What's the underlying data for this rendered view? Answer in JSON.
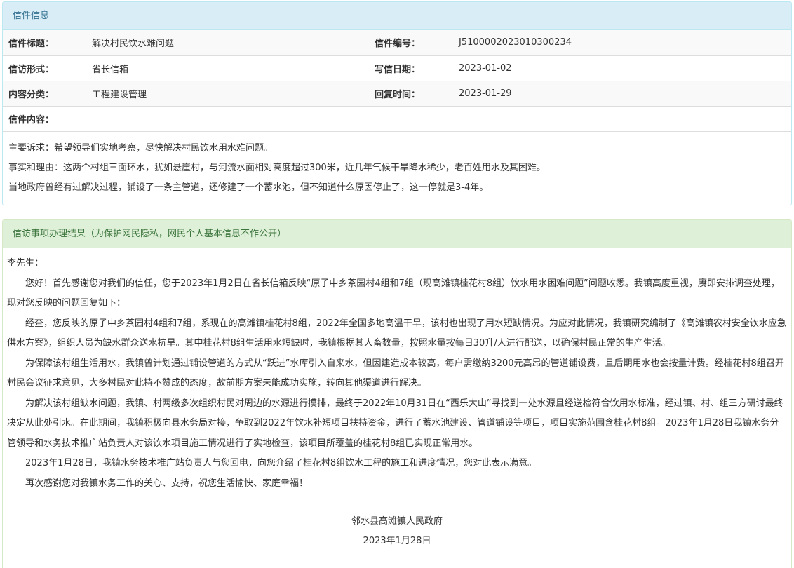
{
  "info": {
    "heading": "信件信息",
    "rows": [
      {
        "l1": "信件标题：",
        "v1": "解决村民饮水难问题",
        "l2": "信件编号：",
        "v2": "J5100002023010300234"
      },
      {
        "l1": "信访形式：",
        "v1": "省长信箱",
        "l2": "写信日期：",
        "v2": "2023-01-02"
      },
      {
        "l1": "内容分类：",
        "v1": "工程建设管理",
        "l2": "回复时间：",
        "v2": "2023-01-29"
      }
    ],
    "content_label": "信件内容：",
    "content_lines": [
      "主要诉求：希望领导们实地考察，尽快解决村民饮水用水难问题。",
      "事实和理由：这两个村组三面环水，犹如悬崖村，与河流水面相对高度超过300米，近几年气候干旱降水稀少，老百姓用水及其困难。",
      "当地政府曾经有过解决过程，铺设了一条主管道，还修建了一个蓄水池，但不知道什么原因停止了，这一停就是3-4年。"
    ]
  },
  "result": {
    "heading": "信访事项办理结果（为保护网民隐私，网民个人基本信息不作公开）",
    "salutation": "李先生：",
    "paragraphs": [
      "您好！首先感谢您对我们的信任，您于2023年1月2日在省长信箱反映“原子中乡茶园村4组和7组（现高滩镇桂花村8组）饮水用水困难问题”问题收悉。我镇高度重视，赓即安排调查处理，现对您反映的问题回复如下：",
      "经查，您反映的原子中乡茶园村4组和7组，系现在的高滩镇桂花村8组，2022年全国多地高温干旱，该村也出现了用水短缺情况。为应对此情况，我镇研究编制了《高滩镇农村安全饮水应急供水方案》，组织人员为缺水群众送水抗旱。其中桂花村8组生活用水短缺时，我镇根据其人畜数量，按照水量按每日30升/人进行配送，以确保村民正常的生产生活。",
      "为保障该村组生活用水，我镇曾计划通过铺设管道的方式从“跃进”水库引入自来水，但因建造成本较高，每户需缴纳3200元高昂的管道铺设费，且后期用水也会按量计费。经桂花村8组召开村民会议征求意见，大多村民对此持不赞成的态度，故前期方案未能成功实施，转向其他渠道进行解决。",
      "为解决该村组缺水问题，我镇、村两级多次组织村民对周边的水源进行摸排，最终于2022年10月31日在“西乐大山”寻找到一处水源且经送检符合饮用水标准，经过镇、村、组三方研讨最终决定从此处引水。在此期间，我镇积极向县水务局对接，争取到2022年饮水补短项目扶持资金，进行了蓄水池建设、管道铺设等项目，项目实施范围含桂花村8组。2023年1月28日我镇水务分管领导和水务技术推广站负责人对该饮水项目施工情况进行了实地检查，该项目所覆盖的桂花村8组已实现正常用水。",
      "2023年1月28日，我镇水务技术推广站负责人与您回电，向您介绍了桂花村8组饮水工程的施工和进度情况，您对此表示满意。",
      "再次感谢您对我镇水务工作的关心、支持，祝您生活愉快、家庭幸福！"
    ],
    "signature_org": "邻水县高滩镇人民政府",
    "signature_date": "2023年1月28日"
  }
}
